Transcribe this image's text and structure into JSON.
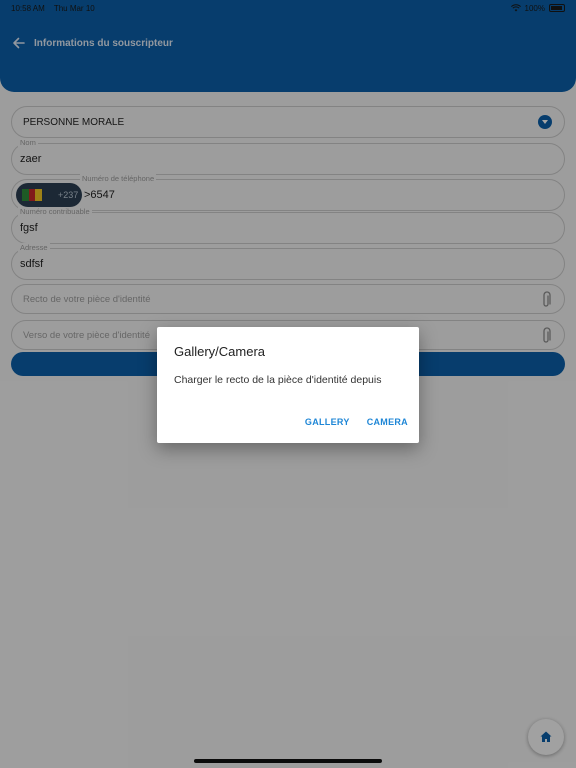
{
  "status_bar": {
    "time": "10:58 AM",
    "date": "Thu Mar 10",
    "battery": "100%",
    "wifi_icon": "wifi-icon",
    "battery_icon": "battery-icon"
  },
  "header": {
    "title": "Informations du souscripteur",
    "back_icon": "arrow-left-icon"
  },
  "form": {
    "type_select": {
      "value": "PERSONNE MORALE"
    },
    "nom": {
      "label": "Nom",
      "value": "zaer"
    },
    "telephone": {
      "label": "Numéro de téléphone",
      "dial_code": "+237",
      "value": ">6547"
    },
    "contribuable": {
      "label": "Numéro contribuable",
      "value": "fgsf"
    },
    "adresse": {
      "label": "Adresse",
      "value": "sdfsf"
    },
    "recto": {
      "placeholder": "Recto de votre pièce d'identité"
    },
    "verso": {
      "placeholder": "Verso de votre pièce d'identité"
    }
  },
  "dialog": {
    "title": "Gallery/Camera",
    "message": "Charger le recto de la pièce d'identité depuis",
    "gallery_label": "GALLERY",
    "camera_label": "CAMERA"
  },
  "colors": {
    "primary": "#0b5fa8",
    "dialog_button": "#1e86d6",
    "flag_green": "#2e8b3a",
    "flag_red": "#c62828",
    "flag_yellow": "#f3c623"
  }
}
